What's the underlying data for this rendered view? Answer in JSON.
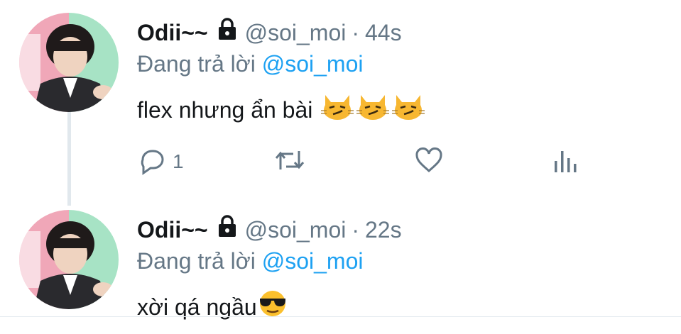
{
  "tweets": [
    {
      "display_name": "Odii~~",
      "handle": "@soi_moi",
      "separator": "·",
      "time": "44s",
      "reply_prefix": "Đang trả lời",
      "reply_to": "@soi_moi",
      "text": "flex nhưng ẩn bài",
      "emojis": [
        "smirk-cat-emoji",
        "smirk-cat-emoji",
        "smirk-cat-emoji"
      ],
      "actions": {
        "reply_count": "1",
        "retweet_count": "",
        "like_count": ""
      }
    },
    {
      "display_name": "Odii~~",
      "handle": "@soi_moi",
      "separator": "·",
      "time": "22s",
      "reply_prefix": "Đang trả lời",
      "reply_to": "@soi_moi",
      "text": "xời qá ngầu",
      "emojis": [
        "sunglasses-face-emoji"
      ]
    }
  ],
  "colors": {
    "name": "#14171a",
    "secondary": "#657786",
    "link": "#1da1f2",
    "thread_line": "#e1e8ed"
  },
  "icons": [
    "lock-icon",
    "reply-icon",
    "retweet-icon",
    "like-icon",
    "analytics-icon"
  ]
}
